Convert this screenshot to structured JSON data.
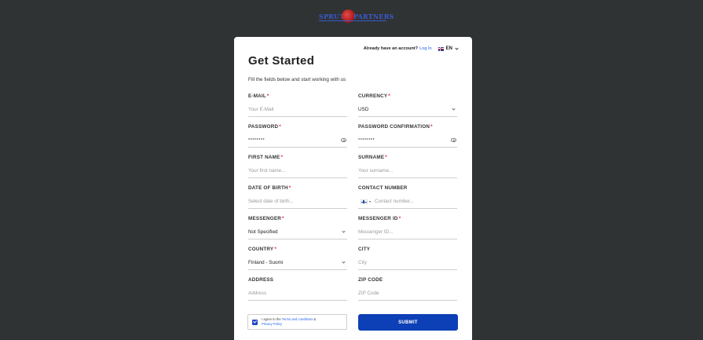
{
  "logo": {
    "left": "SPRUT",
    "right": "PARTNERS"
  },
  "topbar": {
    "question": "Already have an account?",
    "login_label": "Log In",
    "language": "EN"
  },
  "title": "Get Started",
  "subtitle": "Fill the fields below and start working with us",
  "fields": {
    "email": {
      "label": "E-MAIL",
      "placeholder": "Your E-Mail"
    },
    "currency": {
      "label": "CURRENCY",
      "value": "USD"
    },
    "password": {
      "label": "PASSWORD",
      "value": "********"
    },
    "password_confirmation": {
      "label": "PASSWORD CONFIRMATION",
      "value": "********"
    },
    "first_name": {
      "label": "FIRST NAME",
      "placeholder": "Your first name..."
    },
    "surname": {
      "label": "SURNAME",
      "placeholder": "Your surname..."
    },
    "date_of_birth": {
      "label": "DATE OF BIRTH",
      "placeholder": "Select date of birth..."
    },
    "contact_number": {
      "label": "CONTACT NUMBER",
      "placeholder": "Contact number..."
    },
    "messenger": {
      "label": "MESSENGER",
      "value": "Not Specified"
    },
    "messenger_id": {
      "label": "MESSENGER ID",
      "placeholder": "Messenger ID..."
    },
    "country": {
      "label": "COUNTRY",
      "value": "Finland - Suomi"
    },
    "city": {
      "label": "CITY",
      "placeholder": "City"
    },
    "address": {
      "label": "ADDRESS",
      "placeholder": "Address"
    },
    "zip_code": {
      "label": "ZIP CODE",
      "placeholder": "ZIP Code"
    }
  },
  "required_mark": "*",
  "agree": {
    "prefix": "I agree to the",
    "terms": "Terms and conditions",
    "amp": "&",
    "privacy": "Privacy Policy"
  },
  "submit_label": "SUBMIT",
  "colors": {
    "background": "#2f3333",
    "accent": "#0d3fb6",
    "link": "#2563eb",
    "required": "#e0242f"
  }
}
